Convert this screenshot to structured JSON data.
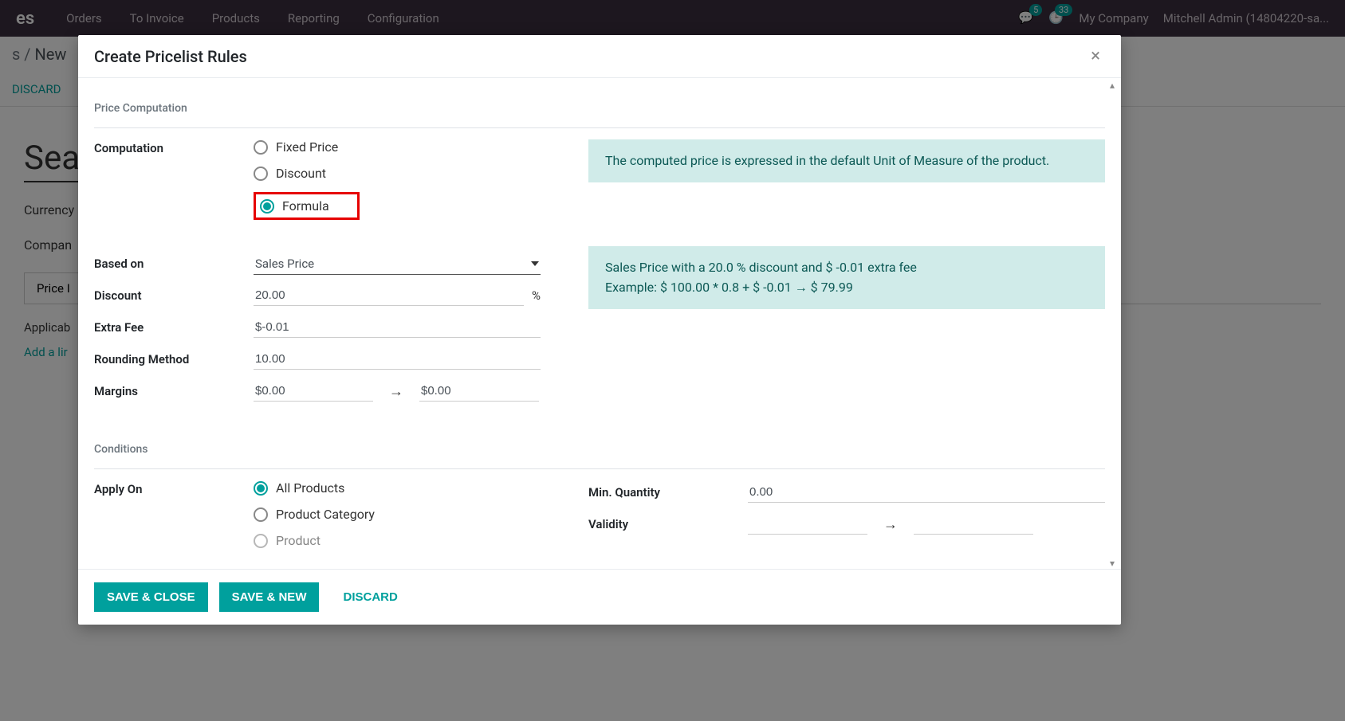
{
  "topbar": {
    "app": "es",
    "nav": [
      "Orders",
      "To Invoice",
      "Products",
      "Reporting",
      "Configuration"
    ],
    "badge1": "5",
    "badge2": "33",
    "company": "My Company",
    "user": "Mitchell Admin (14804220-sa..."
  },
  "breadcrumb": {
    "parent": "s",
    "current": "New"
  },
  "bg_actions": {
    "discard": "DISCARD"
  },
  "bg_form": {
    "heading": "Sea",
    "currency_label": "Currency",
    "company_label": "Compan",
    "tab_label": "Price I",
    "col_applicable": "Applicab",
    "add_line": "Add a lir"
  },
  "modal": {
    "title": "Create Pricelist Rules",
    "section_price_computation": "Price Computation",
    "section_conditions": "Conditions",
    "labels": {
      "computation": "Computation",
      "based_on": "Based on",
      "discount": "Discount",
      "extra_fee": "Extra Fee",
      "rounding_method": "Rounding Method",
      "margins": "Margins",
      "apply_on": "Apply On",
      "min_quantity": "Min. Quantity",
      "validity": "Validity"
    },
    "computation_options": {
      "fixed": "Fixed Price",
      "discount": "Discount",
      "formula": "Formula"
    },
    "info1": "The computed price is expressed in the default Unit of Measure of the product.",
    "info2_line1": "Sales Price with a 20.0 % discount and $ -0.01 extra fee",
    "info2_line2": "Example: $ 100.00 * 0.8 + $ -0.01 → $ 79.99",
    "values": {
      "based_on": "Sales Price",
      "discount": "20.00",
      "discount_suffix": "%",
      "extra_fee": "$-0.01",
      "rounding": "10.00",
      "margin_min": "$0.00",
      "margin_max": "$0.00",
      "min_quantity": "0.00",
      "validity_from": "",
      "validity_to": ""
    },
    "apply_on_options": {
      "all": "All Products",
      "category": "Product Category",
      "product": "Product"
    },
    "footer": {
      "save_close": "SAVE & CLOSE",
      "save_new": "SAVE & NEW",
      "discard": "DISCARD"
    }
  }
}
